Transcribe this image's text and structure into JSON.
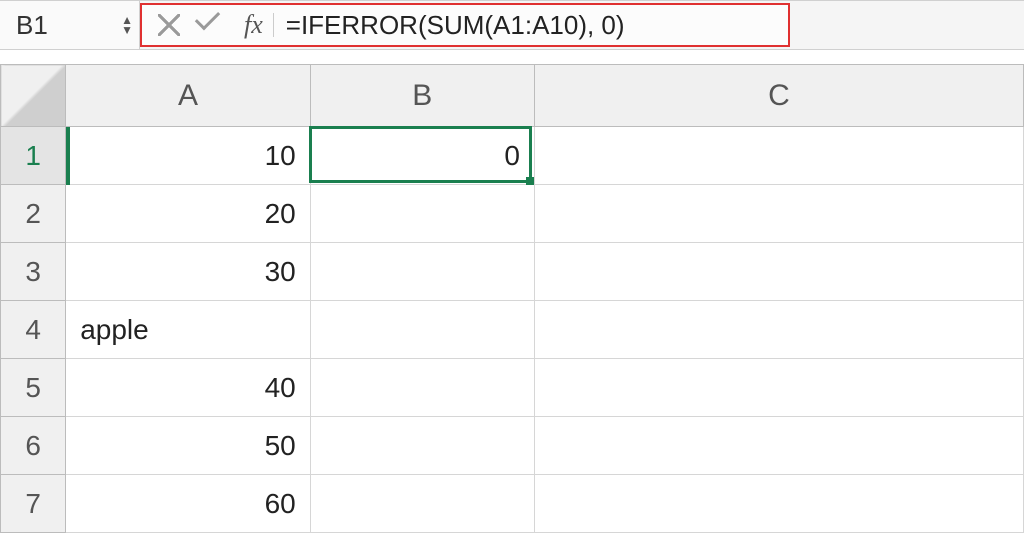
{
  "formula_bar": {
    "cell_ref": "B1",
    "fx_label": "fx",
    "formula": "=IFERROR(SUM(A1:A10), 0)"
  },
  "columns": [
    "A",
    "B",
    "C"
  ],
  "rows": [
    "1",
    "2",
    "3",
    "4",
    "5",
    "6",
    "7"
  ],
  "cells": {
    "A1": {
      "v": "10",
      "align": "num"
    },
    "A2": {
      "v": "20",
      "align": "num"
    },
    "A3": {
      "v": "30",
      "align": "num"
    },
    "A4": {
      "v": "apple",
      "align": "txt"
    },
    "A5": {
      "v": "40",
      "align": "num"
    },
    "A6": {
      "v": "50",
      "align": "num"
    },
    "A7": {
      "v": "60",
      "align": "num"
    },
    "B1": {
      "v": "0",
      "align": "num"
    }
  },
  "selection": {
    "cell": "B1"
  }
}
